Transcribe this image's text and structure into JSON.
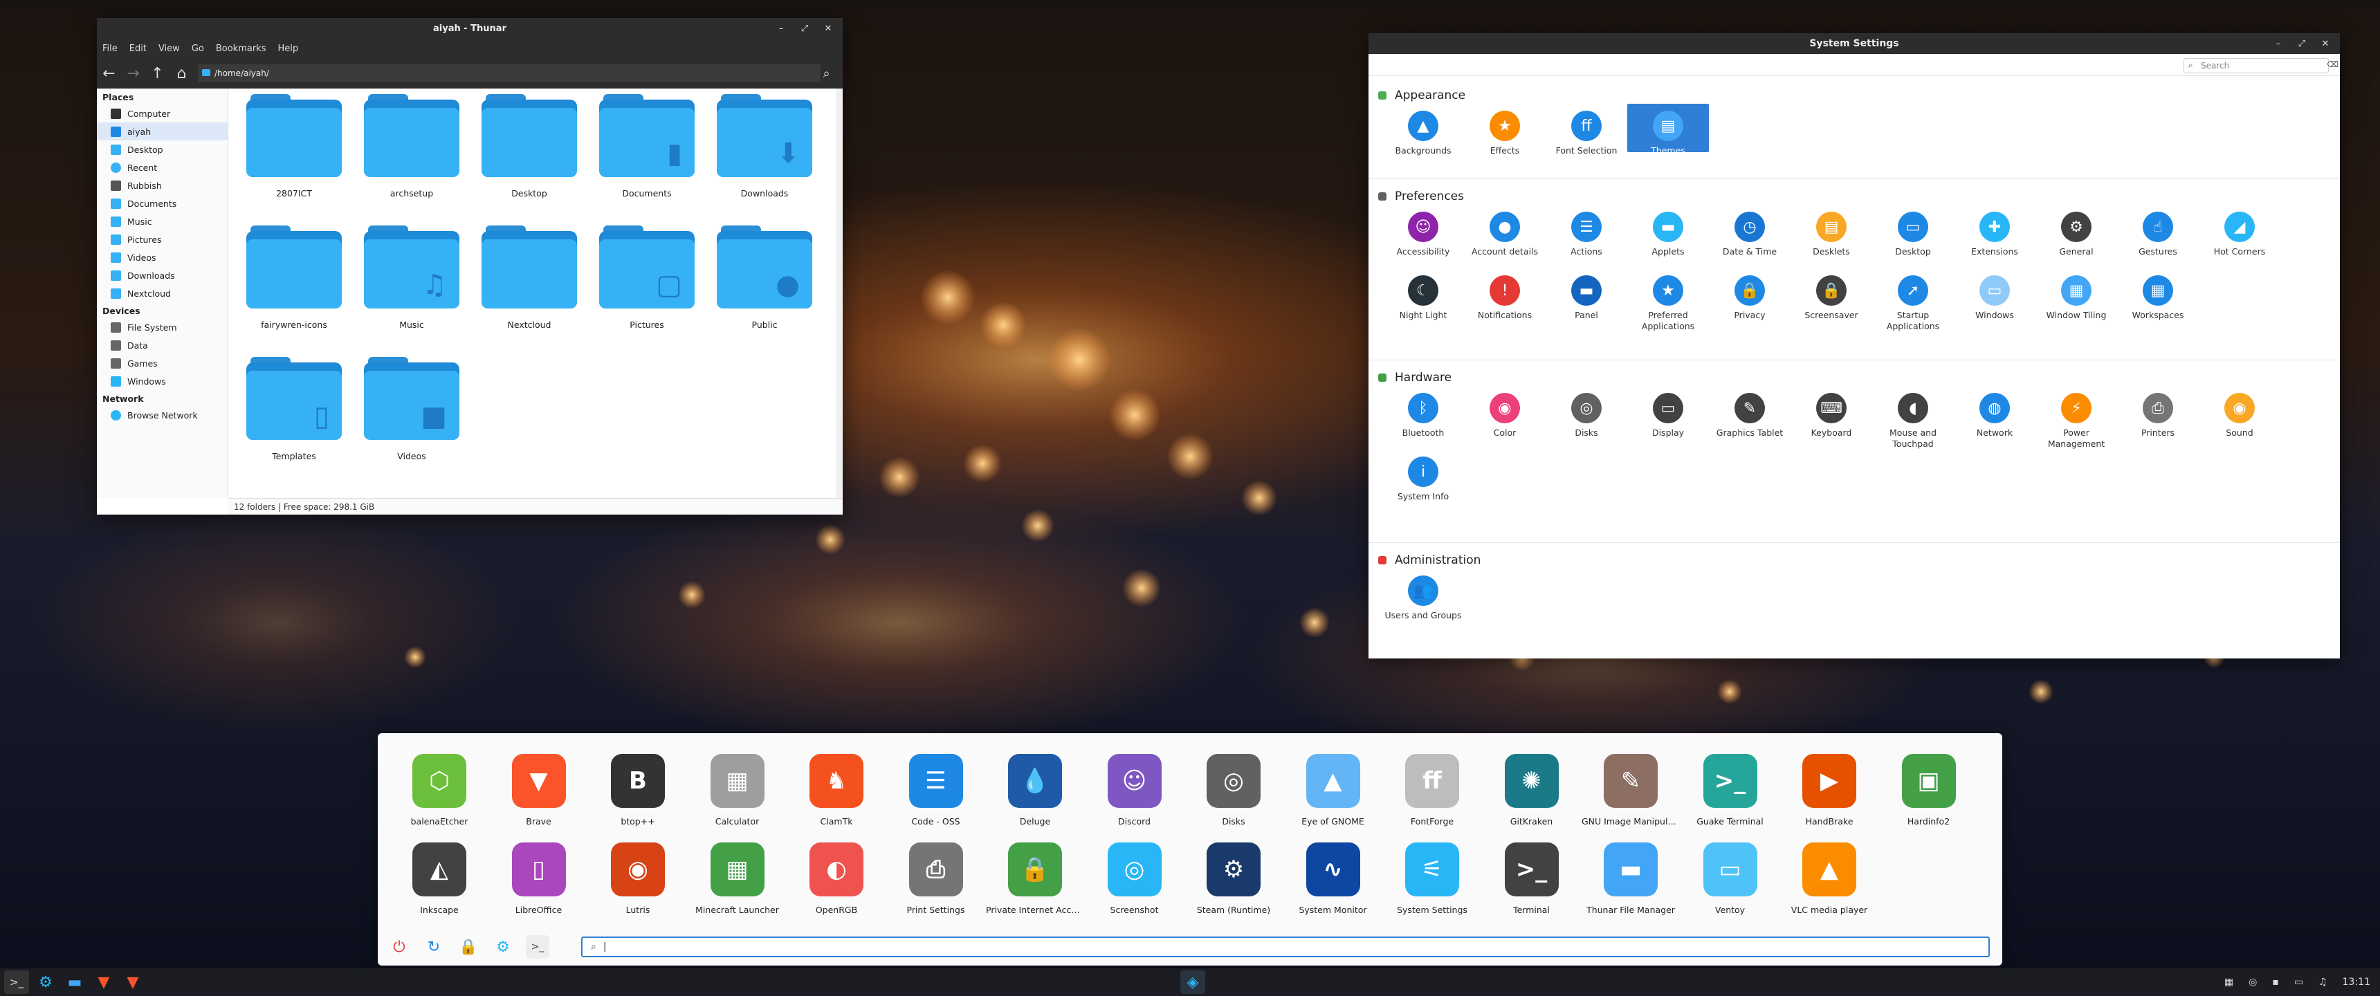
{
  "thunar": {
    "title": "aiyah - Thunar",
    "menu": [
      "File",
      "Edit",
      "View",
      "Go",
      "Bookmarks",
      "Help"
    ],
    "path": "/home/aiyah/",
    "places_header": "Places",
    "places": [
      "Computer",
      "aiyah",
      "Desktop",
      "Recent",
      "Rubbish",
      "Documents",
      "Music",
      "Pictures",
      "Videos",
      "Downloads",
      "Nextcloud"
    ],
    "devices_header": "Devices",
    "devices": [
      "File System",
      "Data",
      "Games",
      "Windows"
    ],
    "network_header": "Network",
    "network": [
      "Browse Network"
    ],
    "folders": [
      {
        "name": "2807ICT",
        "glyph": ""
      },
      {
        "name": "archsetup",
        "glyph": ""
      },
      {
        "name": "Desktop",
        "glyph": ""
      },
      {
        "name": "Documents",
        "glyph": "▮"
      },
      {
        "name": "Downloads",
        "glyph": "⬇"
      },
      {
        "name": "fairywren-icons",
        "glyph": ""
      },
      {
        "name": "Music",
        "glyph": "♫"
      },
      {
        "name": "Nextcloud",
        "glyph": ""
      },
      {
        "name": "Pictures",
        "glyph": "▢"
      },
      {
        "name": "Public",
        "glyph": "●"
      },
      {
        "name": "Templates",
        "glyph": "▯"
      },
      {
        "name": "Videos",
        "glyph": "■"
      }
    ],
    "status": "12 folders  |  Free space: 298.1 GiB"
  },
  "settings": {
    "title": "System Settings",
    "search_placeholder": "Search",
    "categories": [
      {
        "name": "Appearance",
        "color": "#4caf50",
        "items": [
          {
            "label": "Backgrounds",
            "color": "#1e88e5",
            "glyph": "▲"
          },
          {
            "label": "Effects",
            "color": "#fb8c00",
            "glyph": "★"
          },
          {
            "label": "Font Selection",
            "color": "#1e88e5",
            "glyph": "ff"
          },
          {
            "label": "Themes",
            "color": "#42a5f5",
            "glyph": "▤",
            "selected": true
          }
        ]
      },
      {
        "name": "Preferences",
        "color": "#616161",
        "items": [
          {
            "label": "Accessibility",
            "color": "#8e24aa",
            "glyph": "☺"
          },
          {
            "label": "Account details",
            "color": "#1e88e5",
            "glyph": "●"
          },
          {
            "label": "Actions",
            "color": "#1e88e5",
            "glyph": "☰"
          },
          {
            "label": "Applets",
            "color": "#29b6f6",
            "glyph": "▬"
          },
          {
            "label": "Date & Time",
            "color": "#1976d2",
            "glyph": "◷"
          },
          {
            "label": "Desklets",
            "color": "#f9a825",
            "glyph": "▤"
          },
          {
            "label": "Desktop",
            "color": "#1e88e5",
            "glyph": "▭"
          },
          {
            "label": "Extensions",
            "color": "#29b6f6",
            "glyph": "✚"
          },
          {
            "label": "General",
            "color": "#424242",
            "glyph": "⚙"
          },
          {
            "label": "Gestures",
            "color": "#1e88e5",
            "glyph": "☝"
          },
          {
            "label": "Hot Corners",
            "color": "#29b6f6",
            "glyph": "◢"
          },
          {
            "label": "Night Light",
            "color": "#263238",
            "glyph": "☾"
          },
          {
            "label": "Notifications",
            "color": "#e53935",
            "glyph": "!"
          },
          {
            "label": "Panel",
            "color": "#1565c0",
            "glyph": "▬"
          },
          {
            "label": "Preferred Applications",
            "color": "#1e88e5",
            "glyph": "★"
          },
          {
            "label": "Privacy",
            "color": "#1e88e5",
            "glyph": "🔒"
          },
          {
            "label": "Screensaver",
            "color": "#424242",
            "glyph": "🔒"
          },
          {
            "label": "Startup Applications",
            "color": "#1e88e5",
            "glyph": "➚"
          },
          {
            "label": "Windows",
            "color": "#90caf9",
            "glyph": "▭"
          },
          {
            "label": "Window Tiling",
            "color": "#42a5f5",
            "glyph": "▦"
          },
          {
            "label": "Workspaces",
            "color": "#1e88e5",
            "glyph": "▦"
          }
        ]
      },
      {
        "name": "Hardware",
        "color": "#43a047",
        "items": [
          {
            "label": "Bluetooth",
            "color": "#1e88e5",
            "glyph": "ᛒ"
          },
          {
            "label": "Color",
            "color": "#ec407a",
            "glyph": "◉"
          },
          {
            "label": "Disks",
            "color": "#616161",
            "glyph": "◎"
          },
          {
            "label": "Display",
            "color": "#424242",
            "glyph": "▭"
          },
          {
            "label": "Graphics Tablet",
            "color": "#424242",
            "glyph": "✎"
          },
          {
            "label": "Keyboard",
            "color": "#424242",
            "glyph": "⌨"
          },
          {
            "label": "Mouse and Touchpad",
            "color": "#424242",
            "glyph": "◖"
          },
          {
            "label": "Network",
            "color": "#1e88e5",
            "glyph": "◍"
          },
          {
            "label": "Power Management",
            "color": "#fb8c00",
            "glyph": "⚡"
          },
          {
            "label": "Printers",
            "color": "#757575",
            "glyph": "⎙"
          },
          {
            "label": "Sound",
            "color": "#f9a825",
            "glyph": "◉"
          },
          {
            "label": "System Info",
            "color": "#1e88e5",
            "glyph": "i"
          }
        ]
      },
      {
        "name": "Administration",
        "color": "#e53935",
        "items": [
          {
            "label": "Users and Groups",
            "color": "#1e88e5",
            "glyph": "👥"
          }
        ]
      }
    ]
  },
  "launcher": {
    "apps": [
      {
        "label": "balenaEtcher",
        "color": "#6cbf3a",
        "glyph": "⬡"
      },
      {
        "label": "Brave",
        "color": "#fb542b",
        "glyph": "▼"
      },
      {
        "label": "btop++",
        "color": "#333333",
        "glyph": "B"
      },
      {
        "label": "Calculator",
        "color": "#9e9e9e",
        "glyph": "▦"
      },
      {
        "label": "ClamTk",
        "color": "#f4511e",
        "glyph": "♞"
      },
      {
        "label": "Code - OSS",
        "color": "#1e88e5",
        "glyph": "☰"
      },
      {
        "label": "Deluge",
        "color": "#1e5aa8",
        "glyph": "💧"
      },
      {
        "label": "Discord",
        "color": "#7e57c2",
        "glyph": "☺"
      },
      {
        "label": "Disks",
        "color": "#616161",
        "glyph": "◎"
      },
      {
        "label": "Eye of GNOME",
        "color": "#64b5f6",
        "glyph": "▲"
      },
      {
        "label": "FontForge",
        "color": "#bdbdbd",
        "glyph": "ff"
      },
      {
        "label": "GitKraken",
        "color": "#1b7a87",
        "glyph": "✺"
      },
      {
        "label": "GNU Image Manipulation Program",
        "color": "#8d6e63",
        "glyph": "✎"
      },
      {
        "label": "Guake Terminal",
        "color": "#26a69a",
        "glyph": ">_"
      },
      {
        "label": "HandBrake",
        "color": "#e65100",
        "glyph": "▶"
      },
      {
        "label": "Hardinfo2",
        "color": "#43a047",
        "glyph": "▣"
      },
      {
        "label": "Inkscape",
        "color": "#424242",
        "glyph": "◭"
      },
      {
        "label": "LibreOffice",
        "color": "#ab47bc",
        "glyph": "▯"
      },
      {
        "label": "Lutris",
        "color": "#d84315",
        "glyph": "◉"
      },
      {
        "label": "Minecraft Launcher",
        "color": "#43a047",
        "glyph": "▦"
      },
      {
        "label": "OpenRGB",
        "color": "#ef5350",
        "glyph": "◐"
      },
      {
        "label": "Print Settings",
        "color": "#757575",
        "glyph": "⎙"
      },
      {
        "label": "Private Internet Access",
        "color": "#43a047",
        "glyph": "🔒"
      },
      {
        "label": "Screenshot",
        "color": "#29b6f6",
        "glyph": "◎"
      },
      {
        "label": "Steam (Runtime)",
        "color": "#1a3a6b",
        "glyph": "⚙"
      },
      {
        "label": "System Monitor",
        "color": "#0d47a1",
        "glyph": "∿"
      },
      {
        "label": "System Settings",
        "color": "#29b6f6",
        "glyph": "⚟"
      },
      {
        "label": "Terminal",
        "color": "#424242",
        "glyph": ">_"
      },
      {
        "label": "Thunar File Manager",
        "color": "#42a5f5",
        "glyph": "▬"
      },
      {
        "label": "Ventoy",
        "color": "#4fc3f7",
        "glyph": "▭"
      },
      {
        "label": "VLC media player",
        "color": "#fb8c00",
        "glyph": "▲"
      }
    ],
    "quick": [
      {
        "name": "power-icon",
        "glyph": "⏻",
        "color": "#e53935"
      },
      {
        "name": "refresh-icon",
        "glyph": "↻",
        "color": "#1e88e5"
      },
      {
        "name": "lock-icon",
        "glyph": "🔒",
        "color": "#fb8c00"
      },
      {
        "name": "settings-icon",
        "glyph": "⚙",
        "color": "#29b6f6"
      },
      {
        "name": "terminal-icon",
        "glyph": ">_",
        "color": "#424242"
      }
    ],
    "search_value": "|"
  },
  "taskbar": {
    "clock": "13:11"
  }
}
